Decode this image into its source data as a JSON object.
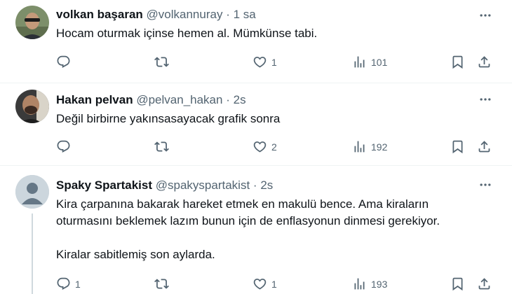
{
  "tweets": [
    {
      "name": "volkan başaran",
      "handle": "@volkannuray",
      "sep": "·",
      "time": "1 sa",
      "text": "Hocam oturmak içinse hemen al. Mümkünse tabi.",
      "likes": "1",
      "views": "101",
      "replies": "",
      "retweets": ""
    },
    {
      "name": "Hakan pelvan",
      "handle": "@pelvan_hakan",
      "sep": "·",
      "time": "2s",
      "text": "Değil birbirne yakınsasayacak grafik  sonra",
      "likes": "2",
      "views": "192",
      "replies": "",
      "retweets": ""
    },
    {
      "name": "Spaky Spartakist",
      "handle": "@spakyspartakist",
      "sep": "·",
      "time": "2s",
      "text": "Kira çarpanına bakarak hareket etmek en makulü bence. Ama kiraların\noturmasını beklemek lazım bunun için de enflasyonun dinmesi gerekiyor.\n\nKiralar sabitlemiş son aylarda.",
      "likes": "1",
      "views": "193",
      "replies": "1",
      "retweets": ""
    }
  ],
  "icons": {
    "reply": "reply-icon",
    "retweet": "retweet-icon",
    "like": "heart-icon",
    "views": "views-icon",
    "bookmark": "bookmark-icon",
    "share": "share-icon",
    "more": "more-icon"
  },
  "colors": {
    "text": "#0f1419",
    "secondary": "#536471",
    "divider": "#eff3f4",
    "thread_line": "#cfd9de"
  }
}
